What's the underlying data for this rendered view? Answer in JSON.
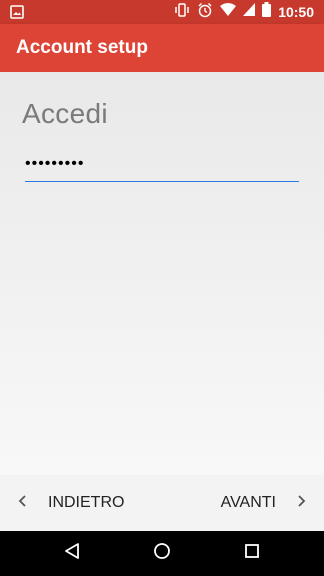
{
  "status_bar": {
    "time": "10:50",
    "icons": [
      "image-notification-icon",
      "vibrate-icon",
      "alarm-icon",
      "wifi-icon",
      "signal-icon",
      "battery-icon"
    ]
  },
  "app_bar": {
    "title": "Account setup"
  },
  "form": {
    "heading": "Accedi",
    "password_value": "•••••••••"
  },
  "footer": {
    "back_label": "INDIETRO",
    "next_label": "AVANTI"
  },
  "colors": {
    "accent": "#de4436",
    "status_bar": "#c7392c",
    "field_underline": "#2a7ae4"
  }
}
